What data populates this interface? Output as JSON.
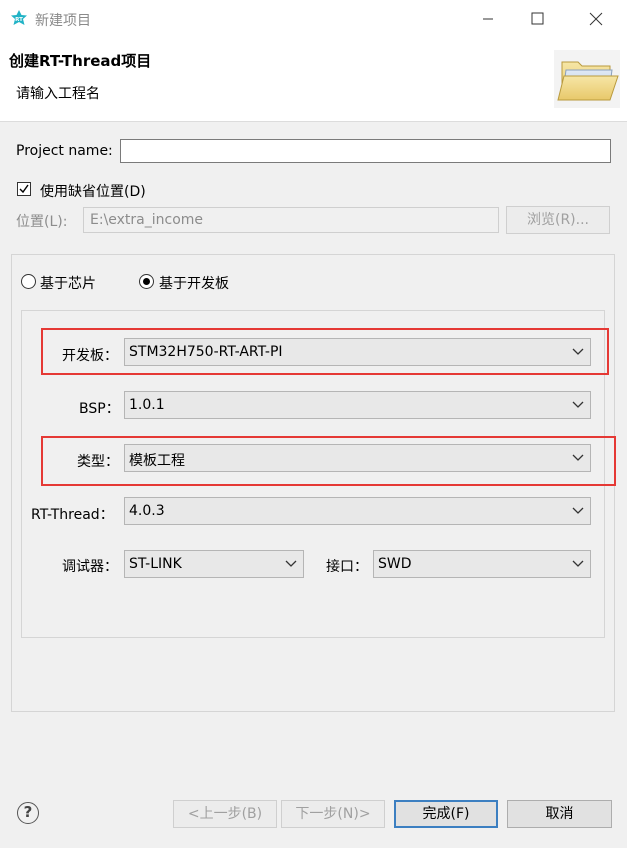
{
  "window": {
    "title": "新建项目",
    "icon": "rt-thread-logo-icon",
    "controls": [
      "minimize-icon",
      "maximize-icon",
      "close-icon"
    ]
  },
  "header": {
    "title": "创建RT-Thread项目",
    "subtitle": "请输入工程名",
    "banner_icon": "folder-open-icon"
  },
  "project": {
    "name_label": "Project name:",
    "name_value": "",
    "use_default_label": "使用缺省位置(D)",
    "use_default_checked": true,
    "location_label": "位置(L):",
    "location_value": "E:\\extra_income",
    "browse_label": "浏览(R)..."
  },
  "mode": {
    "chip_label": "基于芯片",
    "board_label": "基于开发板",
    "selected": "board"
  },
  "board_form": {
    "board_label": "开发板：",
    "board_value": "STM32H750-RT-ART-PI",
    "bsp_label": "BSP：",
    "bsp_value": "1.0.1",
    "type_label": "类型：",
    "type_value": "模板工程",
    "rtthread_label": "RT-Thread：",
    "rtthread_value": "4.0.3",
    "debugger_label": "调试器：",
    "debugger_value": "ST-LINK",
    "interface_label": "接口：",
    "interface_value": "SWD"
  },
  "footer": {
    "help_icon": "help-question-icon",
    "back_label": "<上一步(B)",
    "next_label": "下一步(N)>",
    "finish_label": "完成(F)",
    "cancel_label": "取消"
  },
  "colors": {
    "highlight": "#e53935",
    "default_button_border": "#3c7fc1",
    "rt_logo": "#21b3c6"
  }
}
